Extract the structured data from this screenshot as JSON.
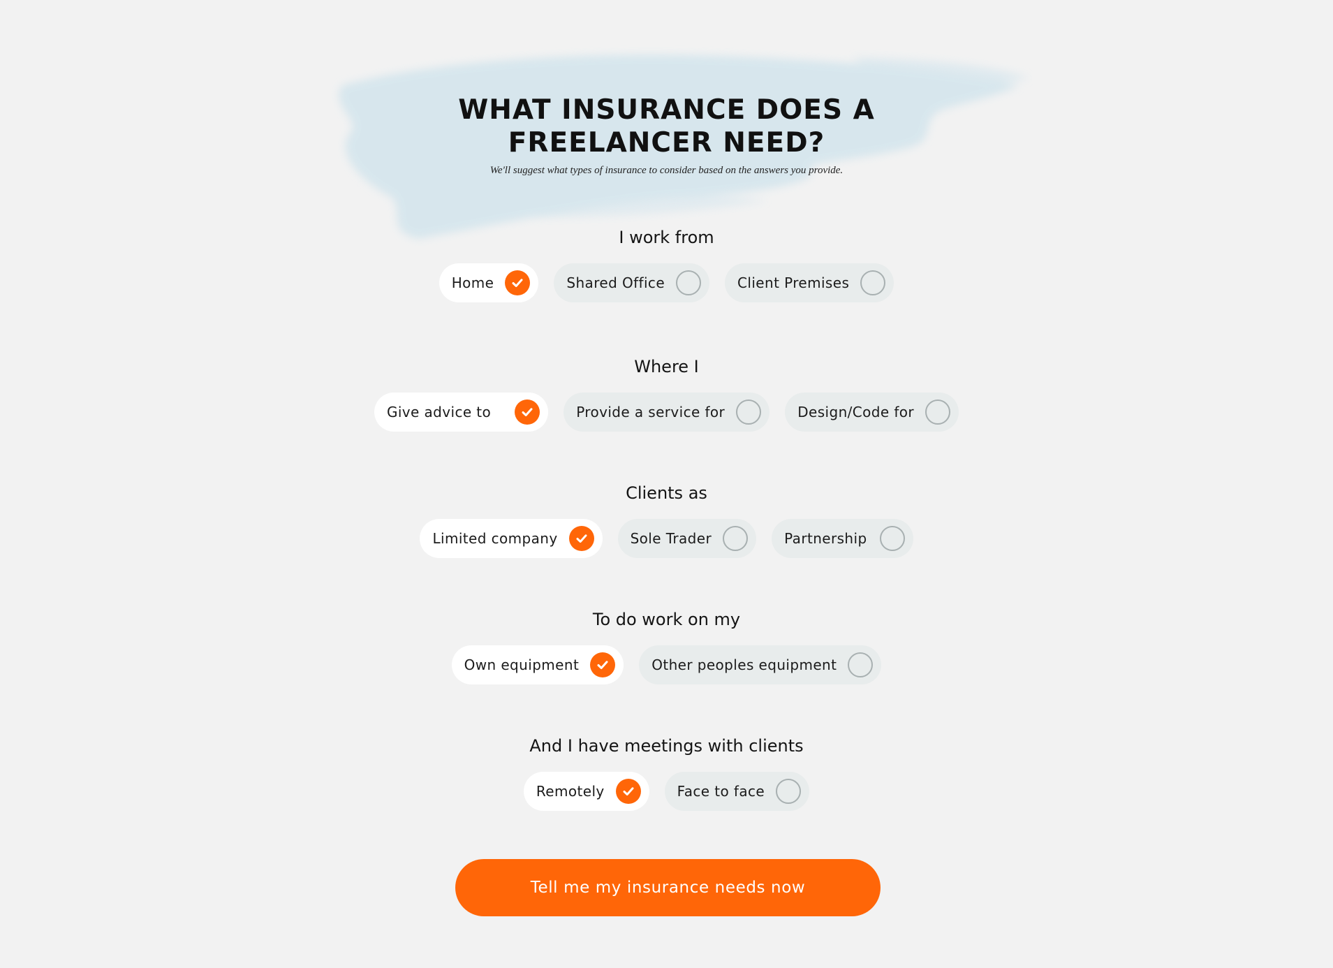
{
  "hero": {
    "title": "WHAT INSURANCE DOES A FREELANCER NEED?",
    "subtitle": "We'll suggest what types of insurance to consider based on the answers you provide."
  },
  "questions": [
    {
      "label": "I work from",
      "options": [
        {
          "label": "Home",
          "selected": true
        },
        {
          "label": "Shared Office",
          "selected": false
        },
        {
          "label": "Client Premises",
          "selected": false
        }
      ]
    },
    {
      "label": "Where I",
      "options": [
        {
          "label": "Give advice to",
          "selected": true
        },
        {
          "label": "Provide a service for",
          "selected": false
        },
        {
          "label": "Design/Code for",
          "selected": false
        }
      ]
    },
    {
      "label": "Clients as",
      "options": [
        {
          "label": "Limited company",
          "selected": true
        },
        {
          "label": "Sole Trader",
          "selected": false
        },
        {
          "label": "Partnership",
          "selected": false
        }
      ]
    },
    {
      "label": "To do work on my",
      "options": [
        {
          "label": "Own equipment",
          "selected": true
        },
        {
          "label": "Other peoples equipment",
          "selected": false
        }
      ]
    },
    {
      "label": "And I have meetings with clients",
      "options": [
        {
          "label": "Remotely",
          "selected": true
        },
        {
          "label": "Face to face",
          "selected": false
        }
      ]
    }
  ],
  "cta": {
    "label": "Tell me my insurance needs now"
  },
  "colors": {
    "accent": "#ff6608",
    "background": "#f2f2f2",
    "option_unselected": "#e8ecec",
    "option_selected": "#ffffff",
    "brush": "#cfe3ec"
  },
  "icons": {
    "selected": "check-circle-icon",
    "unselected": "empty-circle-icon"
  }
}
